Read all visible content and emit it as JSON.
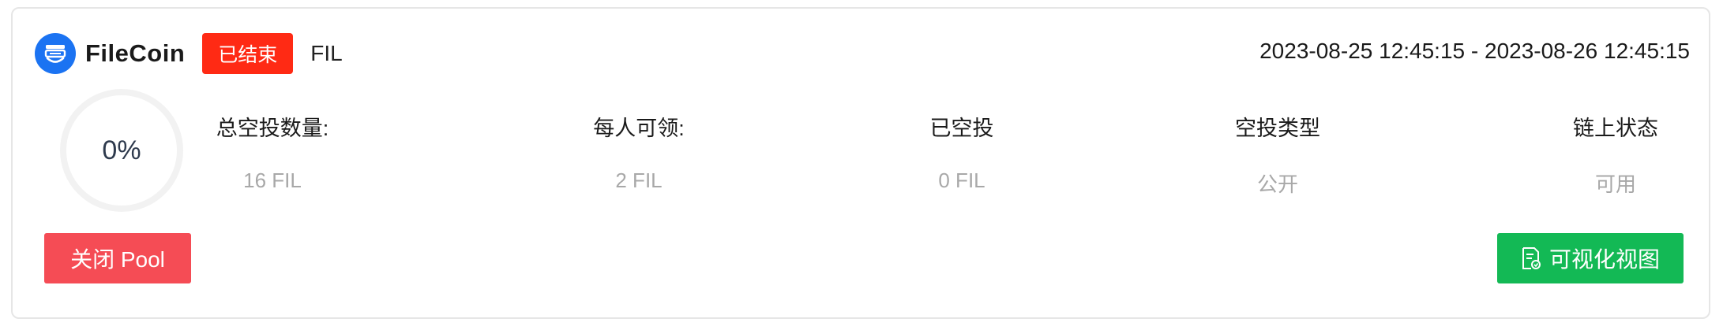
{
  "pool": {
    "coin_name": "FileCoin",
    "status": "已结束",
    "token_symbol": "FIL",
    "time_range": "2023-08-25 12:45:15 - 2023-08-26 12:45:15",
    "progress_text": "0%",
    "progress_value": 0,
    "stats": [
      {
        "label": "总空投数量:",
        "value": "16 FIL"
      },
      {
        "label": "每人可领:",
        "value": "2 FIL"
      },
      {
        "label": "已空投",
        "value": "0 FIL"
      },
      {
        "label": "空投类型",
        "value": "公开"
      },
      {
        "label": "链上状态",
        "value": "可用"
      }
    ],
    "close_button": "关闭 Pool",
    "visualize_button": "可视化视图"
  },
  "colors": {
    "brand_blue": "#1b73f2",
    "status_red": "#ff2a14",
    "close_red": "#f54c55",
    "viz_green": "#13b955",
    "muted_text": "#a8a8a8"
  },
  "icons": {
    "logo": "filecoin-logo-icon",
    "visualize": "document-chart-icon"
  }
}
